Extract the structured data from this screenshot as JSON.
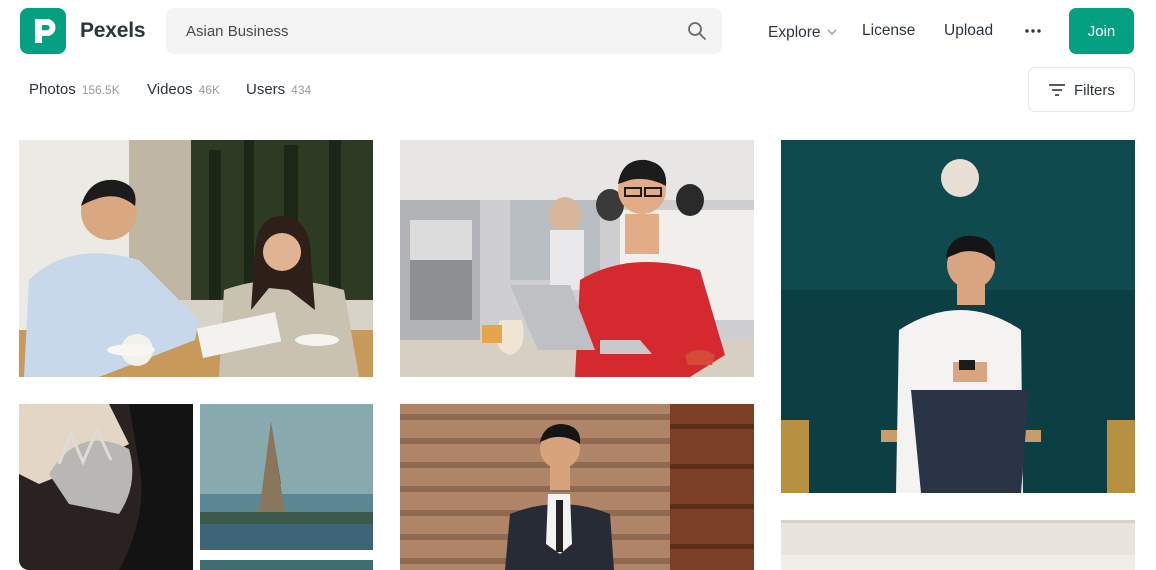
{
  "brand": {
    "name": "Pexels",
    "logo_icon": "pexels-logo-icon",
    "accent_color": "#05a081"
  },
  "search": {
    "value": "Asian Business",
    "icon": "search-icon"
  },
  "nav": {
    "explore": "Explore",
    "license": "License",
    "upload": "Upload",
    "more_icon": "more-dots-icon",
    "join": "Join"
  },
  "tabs": [
    {
      "label": "Photos",
      "count": "156.5K"
    },
    {
      "label": "Videos",
      "count": "46K"
    },
    {
      "label": "Users",
      "count": "434"
    }
  ],
  "filters": {
    "label": "Filters",
    "icon": "filter-lines-icon"
  },
  "photos": [
    {
      "description": "man and woman in business meeting at cafe table"
    },
    {
      "description": "smiling man in red t-shirt working on laptop in cafe"
    },
    {
      "description": "man in white shirt using phone against teal wall"
    },
    {
      "description": "collage: bride with tiara and Wat Arun temple"
    },
    {
      "description": "businessman in suit leaning on wooden wall"
    },
    {
      "description": "partially visible photo"
    }
  ]
}
